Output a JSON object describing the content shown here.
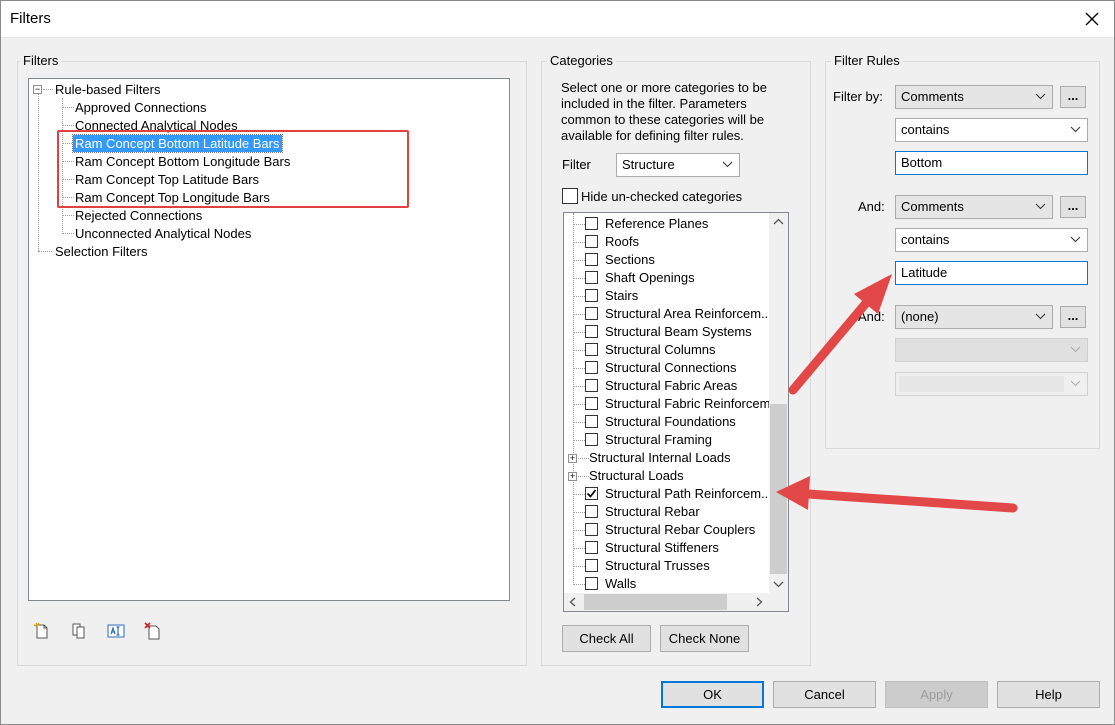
{
  "window": {
    "title": "Filters"
  },
  "filters_panel": {
    "label": "Filters",
    "tree": {
      "root_rule": "Rule-based Filters",
      "items": [
        "Approved Connections",
        "Connected Analytical Nodes",
        "Ram Concept Bottom Latitude Bars",
        "Ram Concept Bottom Longitude Bars",
        "Ram Concept Top Latitude Bars",
        "Ram Concept Top Longitude Bars",
        "Rejected Connections",
        "Unconnected Analytical Nodes"
      ],
      "root_selection": "Selection Filters",
      "selected_index": 2
    },
    "toolbar_icons": [
      "new-filter-icon",
      "duplicate-icon",
      "rename-icon",
      "delete-icon"
    ]
  },
  "categories_panel": {
    "label": "Categories",
    "description": "Select one or more categories to be included in the filter.  Parameters common to these categories will be available for defining filter rules.",
    "filter_label": "Filter",
    "filter_value": "Structure",
    "hide_unchecked_label": "Hide un-checked categories",
    "items": [
      {
        "label": "Reference Planes",
        "checked": false,
        "kind": "child"
      },
      {
        "label": "Roofs",
        "checked": false,
        "kind": "child"
      },
      {
        "label": "Sections",
        "checked": false,
        "kind": "child"
      },
      {
        "label": "Shaft Openings",
        "checked": false,
        "kind": "child"
      },
      {
        "label": "Stairs",
        "checked": false,
        "kind": "child"
      },
      {
        "label": "Structural Area Reinforcem...",
        "checked": false,
        "kind": "child"
      },
      {
        "label": "Structural Beam Systems",
        "checked": false,
        "kind": "child"
      },
      {
        "label": "Structural Columns",
        "checked": false,
        "kind": "child"
      },
      {
        "label": "Structural Connections",
        "checked": false,
        "kind": "child"
      },
      {
        "label": "Structural Fabric Areas",
        "checked": false,
        "kind": "child"
      },
      {
        "label": "Structural Fabric Reinforcem",
        "checked": false,
        "kind": "child"
      },
      {
        "label": "Structural Foundations",
        "checked": false,
        "kind": "child"
      },
      {
        "label": "Structural Framing",
        "checked": false,
        "kind": "child"
      },
      {
        "label": "Structural Internal Loads",
        "checked": false,
        "kind": "group"
      },
      {
        "label": "Structural Loads",
        "checked": false,
        "kind": "group"
      },
      {
        "label": "Structural Path Reinforcem...",
        "checked": true,
        "kind": "child"
      },
      {
        "label": "Structural Rebar",
        "checked": false,
        "kind": "child"
      },
      {
        "label": "Structural Rebar Couplers",
        "checked": false,
        "kind": "child"
      },
      {
        "label": "Structural Stiffeners",
        "checked": false,
        "kind": "child"
      },
      {
        "label": "Structural Trusses",
        "checked": false,
        "kind": "child"
      },
      {
        "label": "Walls",
        "checked": false,
        "kind": "child"
      }
    ],
    "check_all": "Check All",
    "check_none": "Check None"
  },
  "rules_panel": {
    "label": "Filter Rules",
    "filter_by_label": "Filter by:",
    "rule1": {
      "param": "Comments",
      "operator": "contains",
      "value": "Bottom"
    },
    "and1_label": "And:",
    "rule2": {
      "param": "Comments",
      "operator": "contains",
      "value": "Latitude"
    },
    "and2_label": "And:",
    "rule3": {
      "param": "(none)"
    },
    "ellipsis": "..."
  },
  "footer": {
    "ok": "OK",
    "cancel": "Cancel",
    "apply": "Apply",
    "help": "Help"
  },
  "colors": {
    "selection": "#3399ff",
    "annotation": "#e0403f",
    "focus": "#0078d7"
  }
}
